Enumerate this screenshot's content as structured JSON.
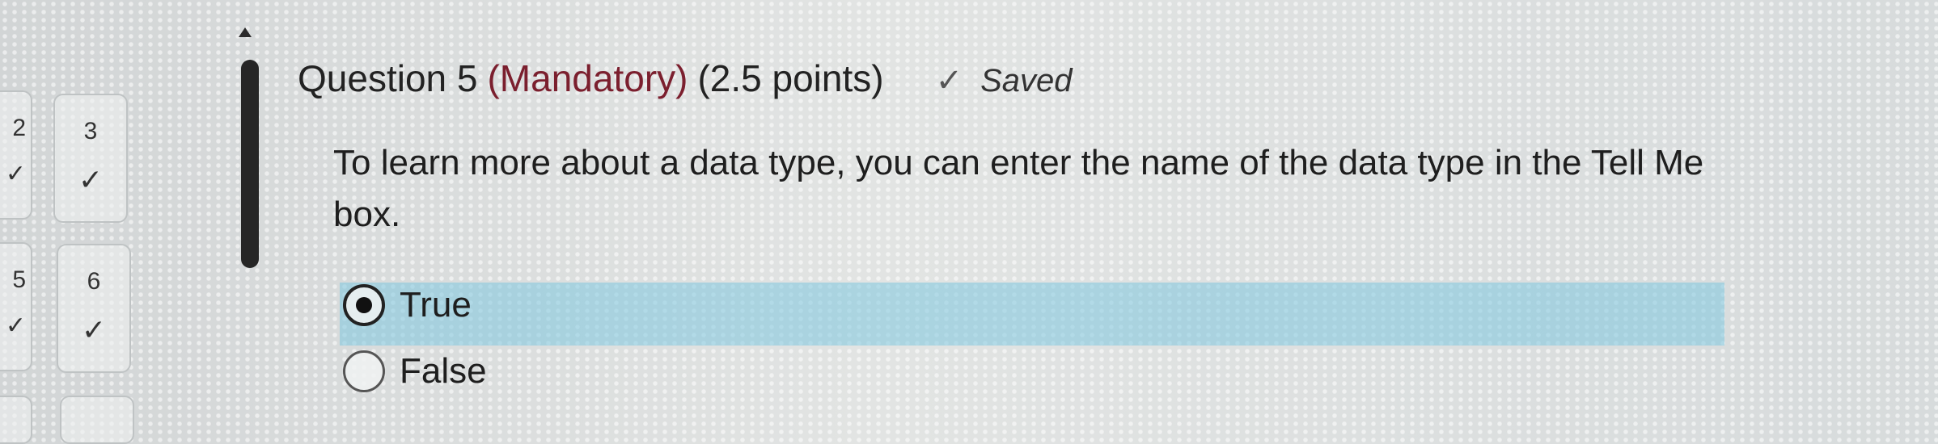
{
  "navigator": {
    "edge_numbers": [
      "2",
      "5"
    ],
    "tiles": [
      {
        "number": "3",
        "status": "answered"
      },
      {
        "number": "6",
        "status": "answered"
      }
    ]
  },
  "question": {
    "title": "Question 5",
    "mandatory": "(Mandatory)",
    "points": "(2.5 points)",
    "saved_label": "Saved",
    "text": "To learn more about a data type, you can enter the name of the data type in the Tell Me box."
  },
  "answers": [
    {
      "label": "True",
      "selected": true
    },
    {
      "label": "False",
      "selected": false
    }
  ],
  "colors": {
    "mandatory": "#7b1f2e",
    "selected_highlight": "#7dc6de"
  },
  "icons": {
    "check": "check-icon",
    "radio": "radio-button"
  }
}
